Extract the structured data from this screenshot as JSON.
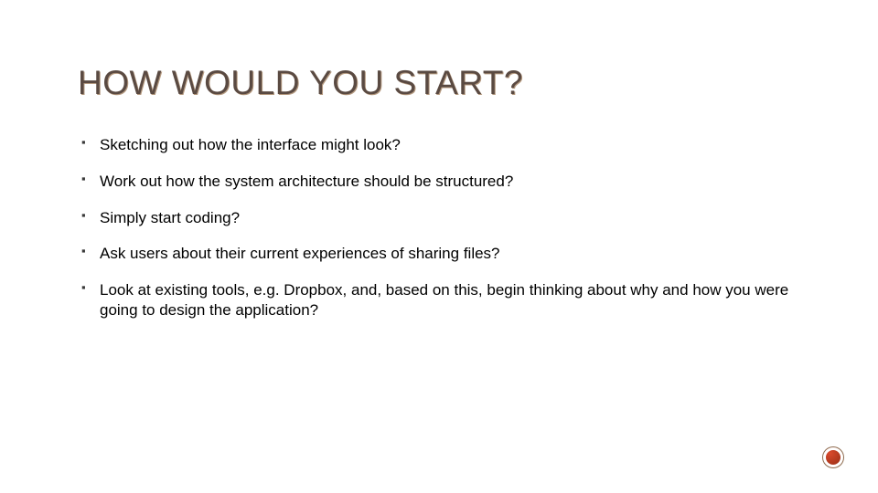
{
  "title": "HOW WOULD YOU START?",
  "bullets": [
    "Sketching out how the interface might look?",
    "Work out how the system architecture should be structured?",
    "Simply start coding?",
    "Ask users about their current experiences of sharing files?",
    "Look at existing tools, e.g. Dropbox, and, based on this, begin thinking about why and how you were going to design the application?"
  ]
}
